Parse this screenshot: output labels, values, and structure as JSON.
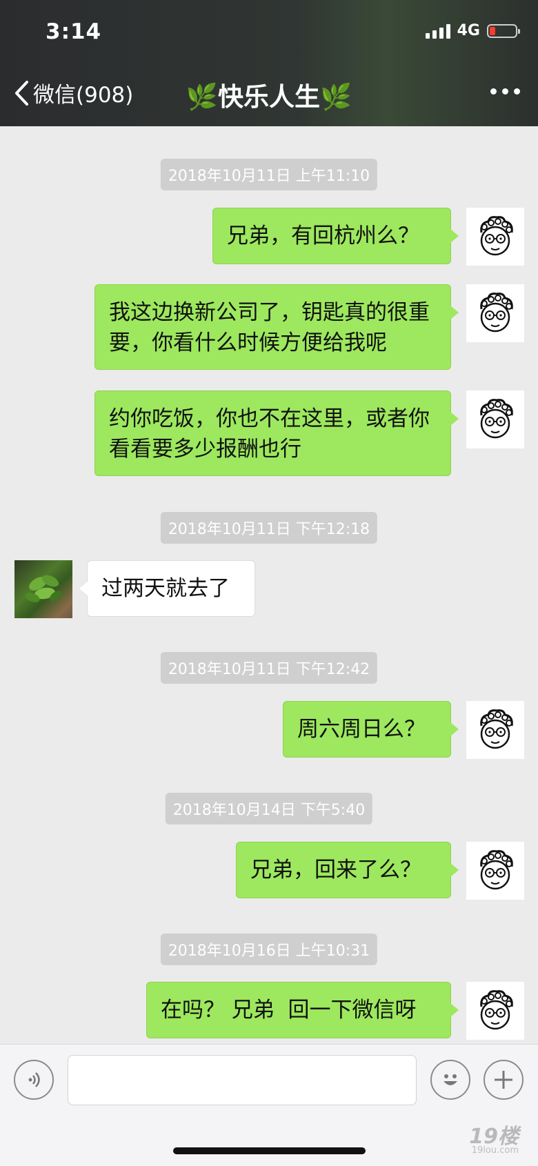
{
  "status_bar": {
    "time": "3:14",
    "network": "4G"
  },
  "nav": {
    "back_label": "微信(908)",
    "title": "🌿快乐人生🌿"
  },
  "messages": [
    {
      "type": "timestamp",
      "text": "2018年10月11日 上午11:10"
    },
    {
      "type": "outgoing",
      "text": "兄弟，有回杭州么？"
    },
    {
      "type": "outgoing",
      "text": "我这边换新公司了，钥匙真的很重要，你看什么时候方便给我呢"
    },
    {
      "type": "outgoing",
      "text": "约你吃饭，你也不在这里，或者你看看要多少报酬也行"
    },
    {
      "type": "timestamp",
      "text": "2018年10月11日 下午12:18"
    },
    {
      "type": "incoming",
      "text": "过两天就去了"
    },
    {
      "type": "timestamp",
      "text": "2018年10月11日 下午12:42"
    },
    {
      "type": "outgoing",
      "text": "周六周日么？"
    },
    {
      "type": "timestamp",
      "text": "2018年10月14日 下午5:40"
    },
    {
      "type": "outgoing",
      "text": "兄弟，回来了么？"
    },
    {
      "type": "timestamp",
      "text": "2018年10月16日 上午10:31"
    },
    {
      "type": "outgoing",
      "text": "在吗？ 兄弟  回一下微信呀"
    }
  ],
  "input_bar": {
    "value": "",
    "placeholder": ""
  },
  "watermark": {
    "text": "19楼",
    "sub": "19lou.com"
  },
  "colors": {
    "outgoing_bubble": "#9de85e",
    "incoming_bubble": "#ffffff",
    "chat_bg": "#ebebeb",
    "header_bg": "#2b2c2e"
  },
  "icons": [
    "back-chevron-icon",
    "more-icon",
    "voice-icon",
    "emoji-icon",
    "add-icon"
  ]
}
